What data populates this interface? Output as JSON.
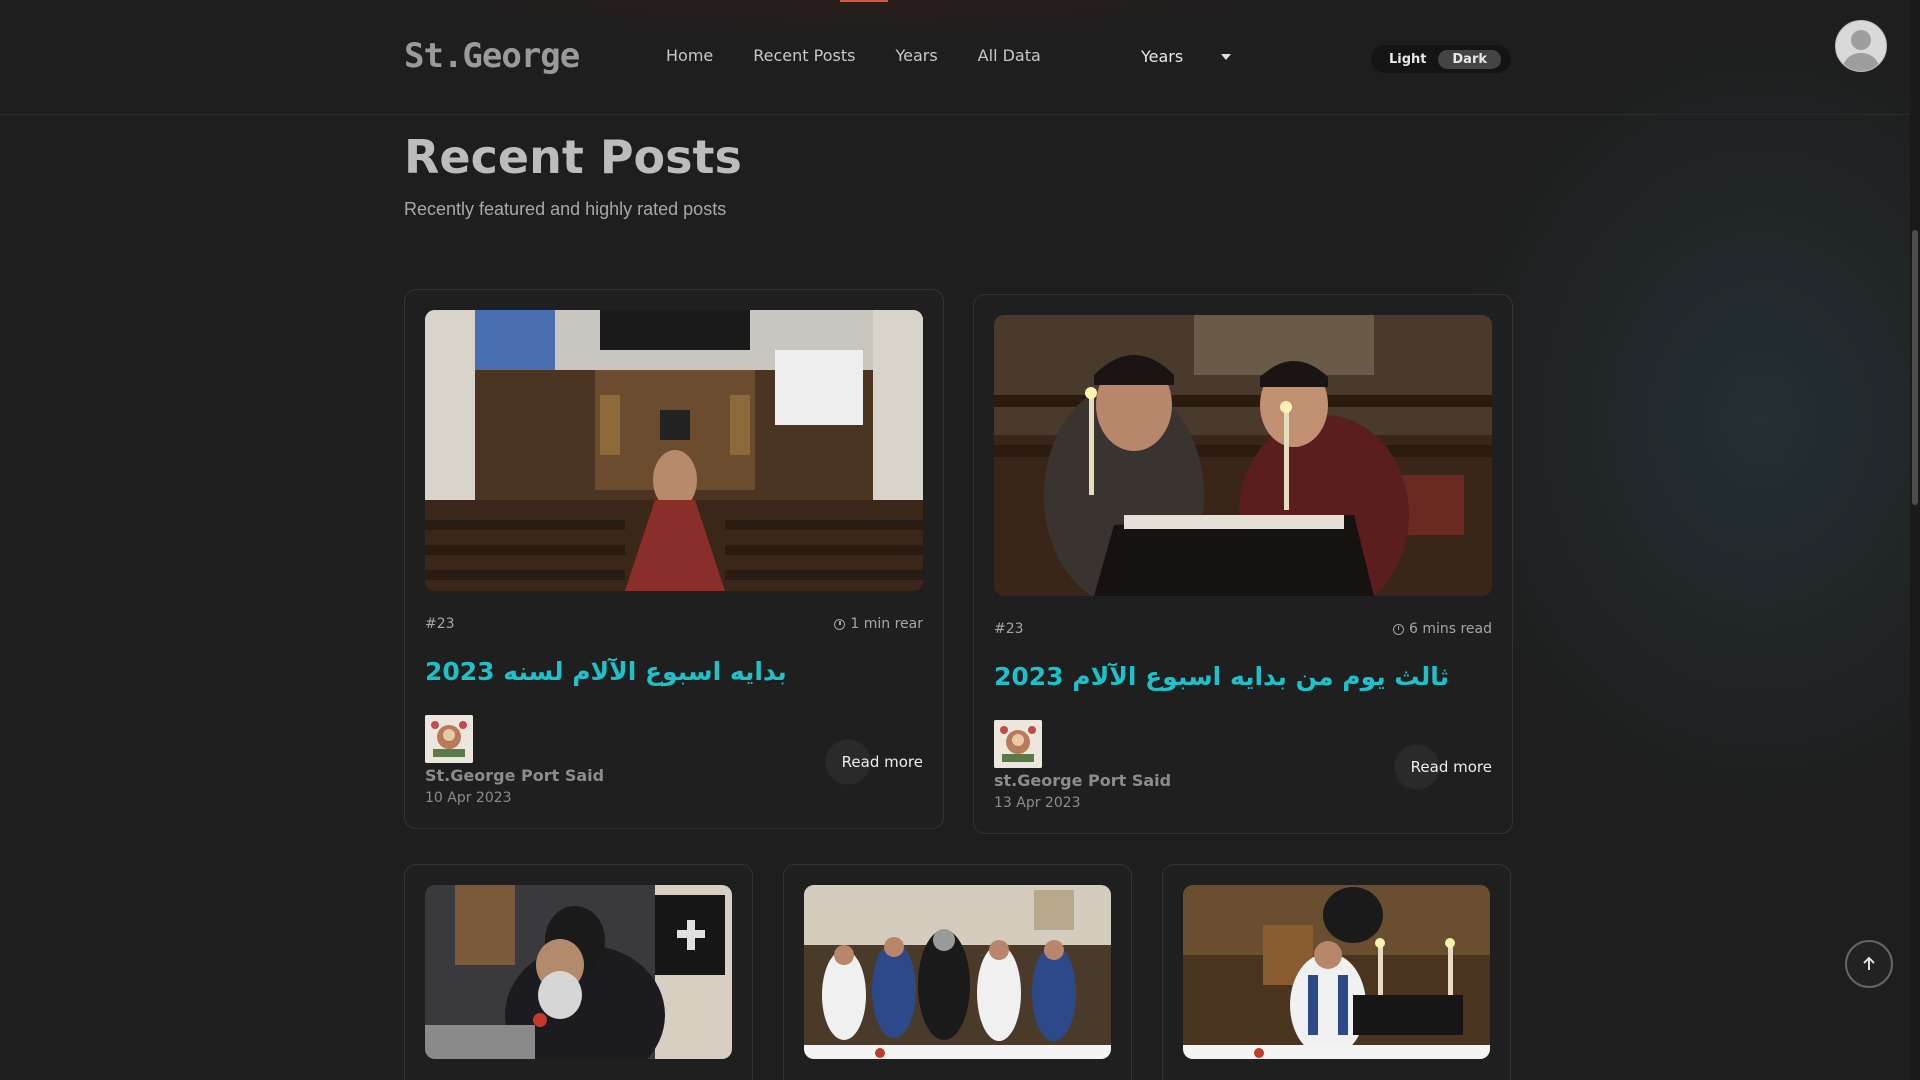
{
  "site": {
    "logo": "St.George"
  },
  "nav": {
    "items": [
      "Home",
      "Recent Posts",
      "Years",
      "All Data"
    ]
  },
  "years_dropdown": {
    "label": "Years"
  },
  "theme_toggle": {
    "light": "Light",
    "dark": "Dark",
    "active": "Dark"
  },
  "section": {
    "title": "Recent Posts",
    "subtitle": "Recently featured and highly rated posts"
  },
  "posts": [
    {
      "tag": "#23",
      "read_time": "1 min rear",
      "title": "بدايه اسبوع الآلام لسنه 2023",
      "author": "St.George Port Said",
      "date": "10 Apr 2023",
      "read_more": "Read more"
    },
    {
      "tag": "#23",
      "read_time": "6 mins read",
      "title": "ثالث يوم من بدايه اسبوع الآلام 2023",
      "author": "st.George Port Said",
      "date": "13 Apr 2023",
      "read_more": "Read more"
    }
  ],
  "colors": {
    "accent": "#1fc1c8",
    "background": "#1e1e1e",
    "top_accent": "#e0523f"
  }
}
